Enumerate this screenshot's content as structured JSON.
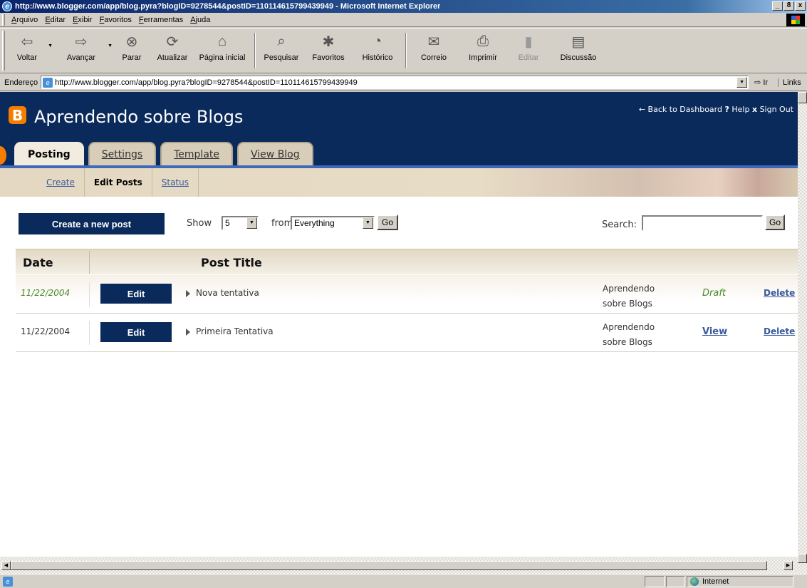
{
  "window": {
    "title": "http://www.blogger.com/app/blog.pyra?blogID=9278544&postID=110114615799439949 - Microsoft Internet Explorer",
    "buttons": [
      "_",
      "8",
      "x"
    ]
  },
  "menubar": {
    "items": [
      "Arquivo",
      "Editar",
      "Exibir",
      "Favoritos",
      "Ferramentas",
      "Ajuda"
    ]
  },
  "toolbar": {
    "items": [
      {
        "label": "Voltar",
        "icon": "back-arrow-icon"
      },
      {
        "label": "Avançar",
        "icon": "forward-arrow-icon"
      },
      {
        "label": "Parar",
        "icon": "stop-icon"
      },
      {
        "label": "Atualizar",
        "icon": "refresh-icon"
      },
      {
        "label": "Página inicial",
        "icon": "home-icon"
      },
      {
        "label": "Pesquisar",
        "icon": "search-icon"
      },
      {
        "label": "Favoritos",
        "icon": "favorites-icon"
      },
      {
        "label": "Histórico",
        "icon": "history-icon"
      },
      {
        "label": "Correio",
        "icon": "mail-icon"
      },
      {
        "label": "Imprimir",
        "icon": "print-icon"
      },
      {
        "label": "Editar",
        "icon": "edit-icon",
        "disabled": true
      },
      {
        "label": "Discussão",
        "icon": "discussion-icon"
      }
    ]
  },
  "addressbar": {
    "label": "Endereço",
    "url": "http://www.blogger.com/app/blog.pyra?blogID=9278544&postID=110114615799439949",
    "go": "Ir",
    "links": "Links"
  },
  "blogger": {
    "logo": "B",
    "blog_title": "Aprendendo sobre Blogs",
    "toplinks": {
      "dashboard": "← Back to Dashboard",
      "help_mark": "?",
      "help": "Help",
      "signout_mark": "x",
      "signout": "Sign Out"
    },
    "tabs": [
      "Posting",
      "Settings",
      "Template",
      "View Blog"
    ],
    "subnav": [
      "Create",
      "Edit Posts",
      "Status"
    ],
    "controls": {
      "new_post": "Create a new post",
      "show": "Show",
      "show_value": "5",
      "from": "from",
      "from_value": "Everything",
      "go": "Go",
      "search": "Search:",
      "search_go": "Go"
    },
    "table": {
      "headers": {
        "date": "Date",
        "title": "Post Title"
      },
      "rows": [
        {
          "date": "11/22/2004",
          "edit": "Edit",
          "title": "Nova tentativa",
          "blog_l1": "Aprendendo",
          "blog_l2": "sobre Blogs",
          "state": "Draft",
          "delete": "Delete"
        },
        {
          "date": "11/22/2004",
          "edit": "Edit",
          "title": "Primeira Tentativa",
          "blog_l1": "Aprendendo",
          "blog_l2": "sobre Blogs",
          "state": "View",
          "delete": "Delete"
        }
      ]
    }
  },
  "statusbar": {
    "zone": "Internet"
  }
}
